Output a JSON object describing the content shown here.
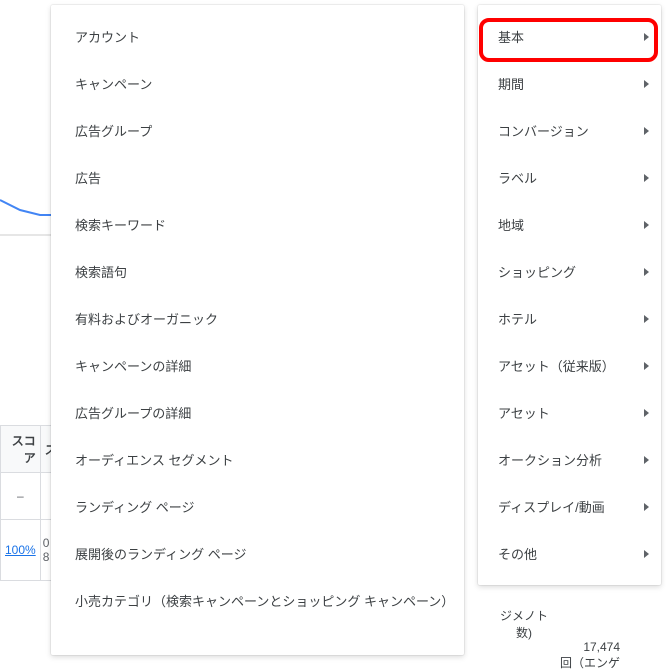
{
  "background": {
    "header_cell": "スコア",
    "row_dash": "–",
    "link_text": "100%",
    "link_prefix": "0",
    "link_suffix": "8",
    "under_right_a": "ジメノト",
    "under_right_b": "数)",
    "under_right_val": "17,474",
    "under_right_sub": "回（エンゲ"
  },
  "left_menu": {
    "items": [
      "アカウント",
      "キャンペーン",
      "広告グループ",
      "広告",
      "検索キーワード",
      "検索語句",
      "有料およびオーガニック",
      "キャンペーンの詳細",
      "広告グループの詳細",
      "オーディエンス セグメント",
      "ランディング ページ",
      "展開後のランディング ページ",
      "小売カテゴリ（検索キャンペーンとショッピング キャンペーン）"
    ]
  },
  "right_menu": {
    "items": [
      "基本",
      "期間",
      "コンバージョン",
      "ラベル",
      "地域",
      "ショッピング",
      "ホテル",
      "アセット（従来版）",
      "アセット",
      "オークション分析",
      "ディスプレイ/動画",
      "その他"
    ]
  }
}
